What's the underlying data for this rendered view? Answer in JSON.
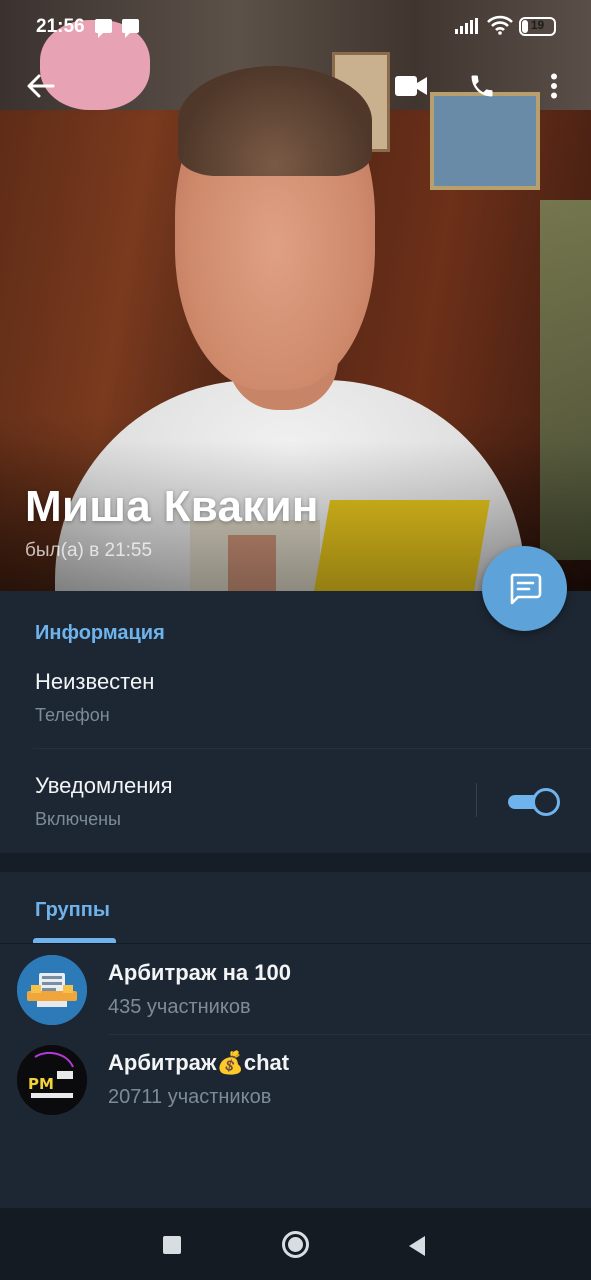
{
  "status_bar": {
    "time": "21:56",
    "battery": "19",
    "battery_level": 0.19,
    "icons": [
      "message-icon",
      "message-icon",
      "signal-icon",
      "wifi-icon",
      "battery-icon"
    ]
  },
  "toolbar": {
    "back_icon": "arrow-left-icon",
    "video_icon": "video-camera-icon",
    "call_icon": "phone-icon",
    "more_icon": "more-vertical-icon"
  },
  "profile": {
    "name": "Миша Квакин",
    "status": "был(а) в 21:55"
  },
  "fab": {
    "icon": "message-icon"
  },
  "info": {
    "title": "Информация",
    "phone_value": "Неизвестен",
    "phone_label": "Телефон",
    "notifications_label": "Уведомления",
    "notifications_state": "Включены",
    "notifications_on": true
  },
  "groups": {
    "tab_label": "Группы",
    "items": [
      {
        "title": "Арбитраж на 100",
        "subtitle": "435 участников"
      },
      {
        "title": "Арбитраж💰chat",
        "subtitle": "20711 участников",
        "avatar_text": "PM"
      }
    ]
  },
  "navbar": {
    "icons": [
      "square-icon",
      "circle-icon",
      "triangle-back-icon"
    ]
  },
  "colors": {
    "accent": "#6fb3ec",
    "fab": "#5ea2da",
    "background": "#1d2733",
    "secondary_text": "#7d8b99"
  }
}
